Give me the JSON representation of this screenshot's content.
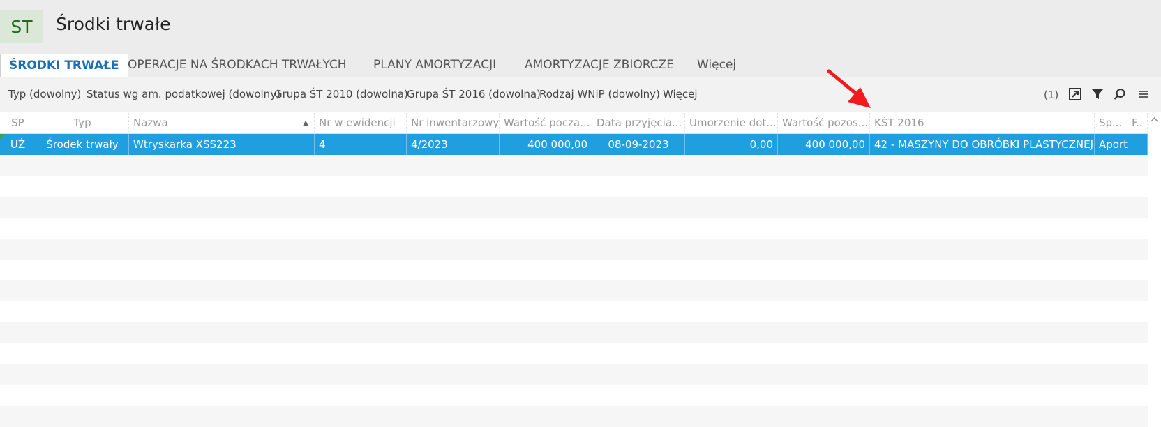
{
  "app": {
    "badge": "ST",
    "title": "Środki trwałe"
  },
  "tabs": [
    {
      "label": "ŚRODKI TRWAŁE",
      "active": true
    },
    {
      "label": "OPERACJE NA ŚRODKACH TRWAŁYCH"
    },
    {
      "label": "PLANY AMORTYZACJI"
    },
    {
      "label": "AMORTYZACJE ZBIORCZE"
    },
    {
      "label": "Więcej"
    }
  ],
  "filters": [
    "Typ (dowolny)",
    "Status wg am. podatkowej (dowolny)",
    "Grupa ŚT 2010 (dowolna)",
    "Grupa ŚT 2016 (dowolna)",
    "Rodzaj WNiP (dowolny)",
    "Więcej"
  ],
  "toolbar": {
    "count": "(1)"
  },
  "columns": [
    "SP",
    "Typ",
    "Nazwa",
    "Nr w ewidencji",
    "Nr inwentarzowy",
    "Wartość począ...",
    "Data przyjęcia...",
    "Umorzenie dot...",
    "Wartość pozos...",
    "KŚT 2016",
    "Sp...",
    "F.."
  ],
  "rows": [
    {
      "sp": "UŻ",
      "typ": "Środek trwały",
      "nazwa": "Wtryskarka XSS223",
      "nr_ewidencji": "4",
      "nr_inwentarzowy": "4/2023",
      "wartosc_poczatkowa": "400 000,00",
      "data_przyjecia": "08-09-2023",
      "umorzenie": "0,00",
      "wartosc_pozostala": "400 000,00",
      "kst_2016": "42 - MASZYNY DO OBRÓBKI PLASTYCZNEJ...",
      "sposob": "Aport"
    }
  ],
  "colors": {
    "accent": "#1f6fb0",
    "selection": "#1f9fdf",
    "annotation_arrow": "#ee1c1c"
  }
}
